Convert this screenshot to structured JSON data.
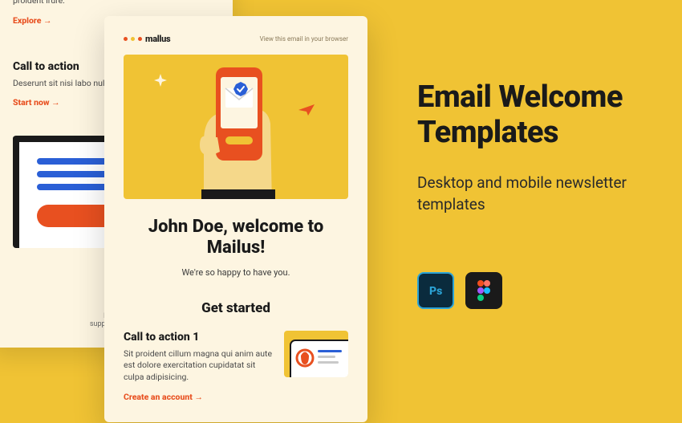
{
  "marketing": {
    "title": "Email Welcome Templates",
    "subtitle": "Desktop and mobile newsletter templates"
  },
  "back_card": {
    "explore_link": "Explore →",
    "cta2_title": "Call to action",
    "cta2_body": "Deserunt sit nisi labo nulla.",
    "cta2_link": "Start now →",
    "footer_prefix": "If you",
    "footer_email": "support@mail"
  },
  "front_card": {
    "brand": "mallus",
    "view_browser": "View this email in your browser",
    "welcome_heading": "John Doe, welcome to Mailus!",
    "welcome_sub": "We're so happy to have you.",
    "get_started": "Get started",
    "cta1_title": "Call to action 1",
    "cta1_body": "Sit proident cillum magna qui anim aute est dolore exercitation cupidatat sit culpa adipisicing.",
    "cta1_link": "Create an account →"
  }
}
